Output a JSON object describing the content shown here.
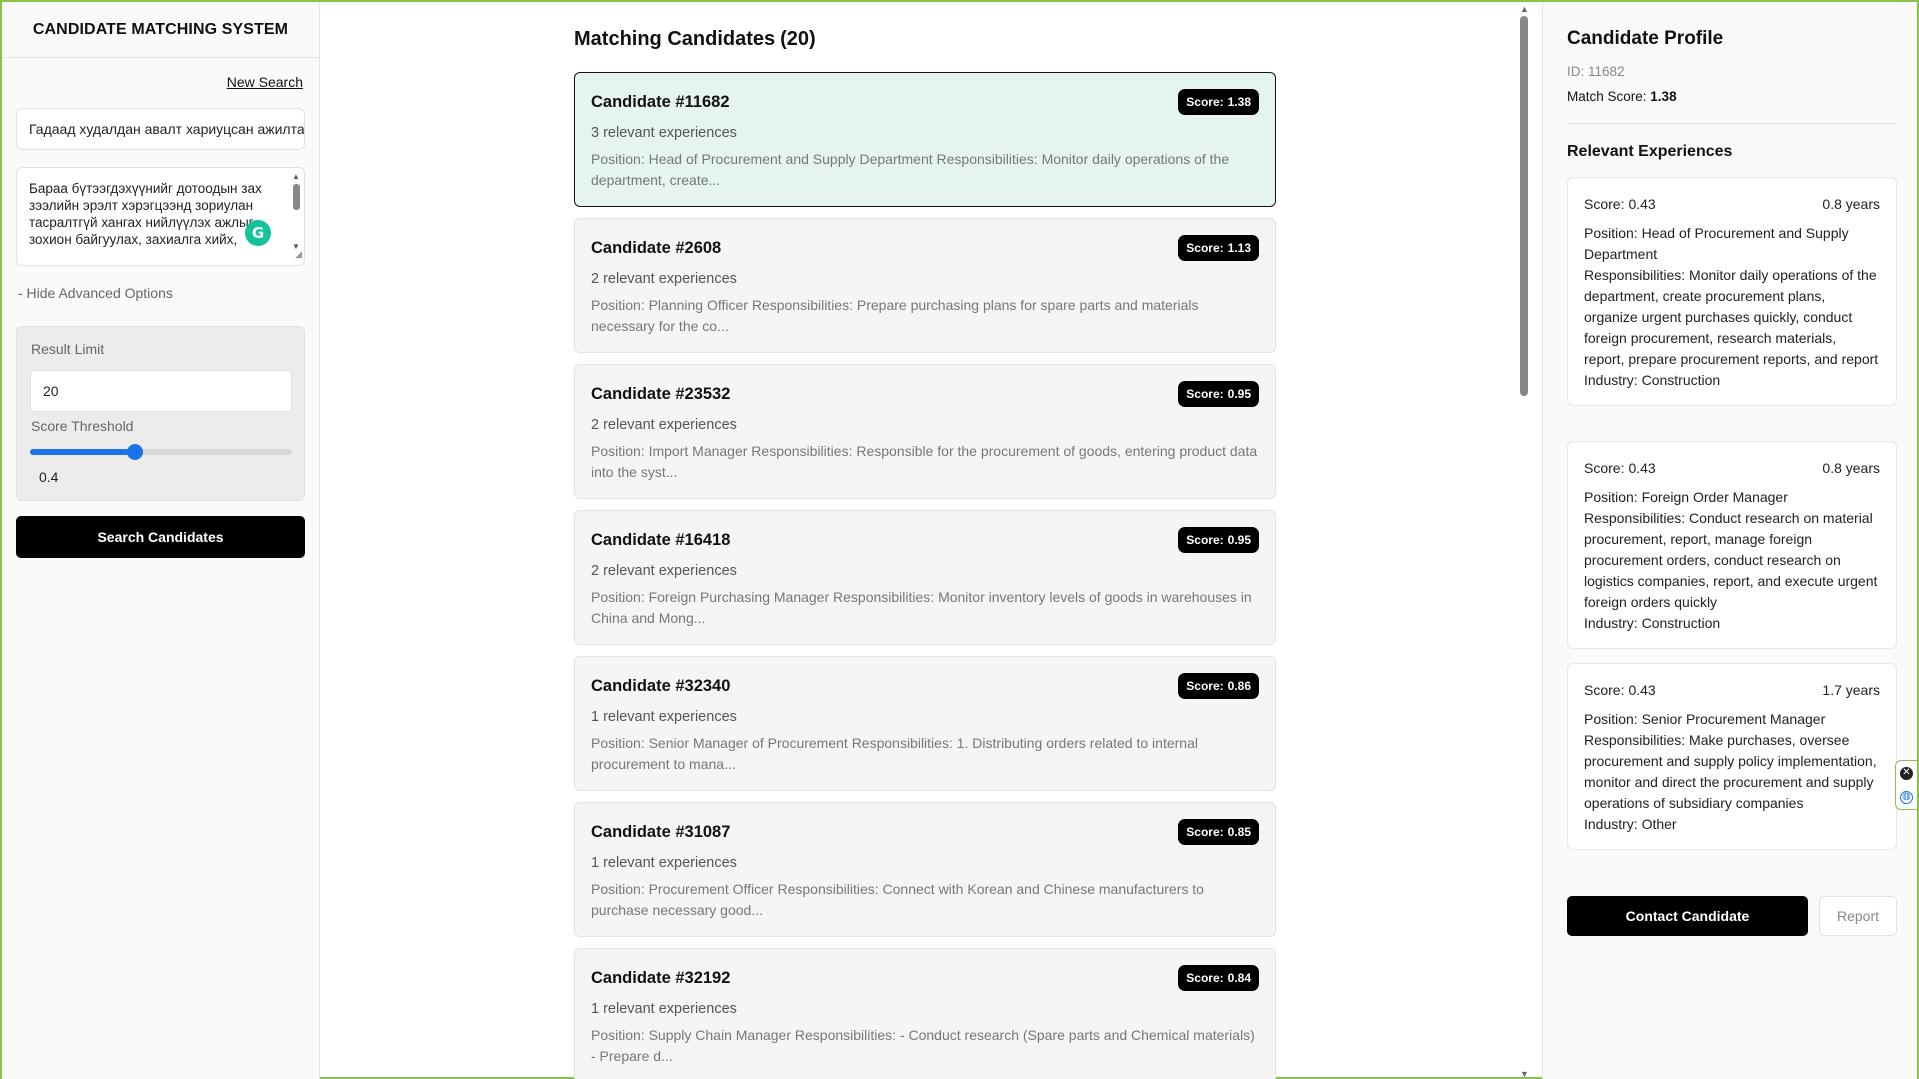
{
  "app": {
    "title": "CANDIDATE MATCHING SYSTEM"
  },
  "sidebar": {
    "new_search_label": "New Search",
    "query_value": "Гадаад худалдан авалт хариуцсан ажилтан",
    "description_value": "Бараа бүтээгдэхүүнийг дотоодын зах зээлийн эрэлт хэрэгцээнд зориулан тасралтгүй хангах нийлүүлэх ажлыг зохион байгуулах, захиалга хийх,",
    "hide_advanced_label": "- Hide Advanced Options",
    "result_limit_label": "Result Limit",
    "result_limit_value": "20",
    "score_threshold_label": "Score Threshold",
    "score_threshold_value": "0.4",
    "score_threshold_fraction": 0.4,
    "search_button_label": "Search Candidates"
  },
  "main": {
    "title": "Matching Candidates",
    "count": "(20)",
    "score_label": "Score:",
    "experiences_suffix": "relevant experiences",
    "candidates": [
      {
        "name": "Candidate #11682",
        "score": "1.38",
        "experiences": "3",
        "description": "Position: Head of Procurement and Supply Department Responsibilities: Monitor daily operations of the department, create..."
      },
      {
        "name": "Candidate #2608",
        "score": "1.13",
        "experiences": "2",
        "description": "Position: Planning Officer Responsibilities: Prepare purchasing plans for spare parts and materials necessary for the co..."
      },
      {
        "name": "Candidate #23532",
        "score": "0.95",
        "experiences": "2",
        "description": "Position: Import Manager Responsibilities: Responsible for the procurement of goods, entering product data into the syst..."
      },
      {
        "name": "Candidate #16418",
        "score": "0.95",
        "experiences": "2",
        "description": "Position: Foreign Purchasing Manager Responsibilities: Monitor inventory levels of goods in warehouses in China and Mong..."
      },
      {
        "name": "Candidate #32340",
        "score": "0.86",
        "experiences": "1",
        "description": "Position: Senior Manager of Procurement Responsibilities: 1. Distributing orders related to internal procurement to mana..."
      },
      {
        "name": "Candidate #31087",
        "score": "0.85",
        "experiences": "1",
        "description": "Position: Procurement Officer Responsibilities: Connect with Korean and Chinese manufacturers to purchase necessary good..."
      },
      {
        "name": "Candidate #32192",
        "score": "0.84",
        "experiences": "1",
        "description": "Position: Supply Chain Manager Responsibilities: - Conduct research (Spare parts and Chemical materials) - Prepare d..."
      }
    ]
  },
  "profile": {
    "title": "Candidate Profile",
    "id_text": "ID: 11682",
    "match_score_label": "Match Score:",
    "match_score_value": "1.38",
    "relevant_title": "Relevant Experiences",
    "score_label": "Score:",
    "experiences": [
      {
        "score": "0.43",
        "years": "0.8 years",
        "position": "Position: Head of Procurement and Supply Department",
        "responsibilities": "Responsibilities: Monitor daily operations of the department, create procurement plans, organize urgent purchases quickly, conduct foreign procurement, research materials, report, prepare procurement reports, and report",
        "industry": "Industry: Construction"
      },
      {
        "score": "0.43",
        "years": "0.8 years",
        "position": "Position: Foreign Order Manager",
        "responsibilities": "Responsibilities: Conduct research on material procurement, report, manage foreign procurement orders, conduct research on logistics companies, report, and execute urgent foreign orders quickly",
        "industry": "Industry: Construction"
      },
      {
        "score": "0.43",
        "years": "1.7 years",
        "position": "Position: Senior Procurement Manager",
        "responsibilities": "Responsibilities: Make purchases, oversee procurement and supply policy implementation, monitor and direct the procurement and supply operations of subsidiary companies",
        "industry": "Industry: Other"
      }
    ],
    "contact_button_label": "Contact Candidate",
    "report_button_label": "Report"
  },
  "icons": {
    "grammarly": "grammarly-icon",
    "extension_close": "close-icon",
    "extension_globe": "globe-icon"
  },
  "colors": {
    "accent": "#1a73e8",
    "selected_card_bg": "#e6f4f1",
    "button_bg": "#000000",
    "window_border": "#8bc34a",
    "grammarly": "#15c39a"
  }
}
